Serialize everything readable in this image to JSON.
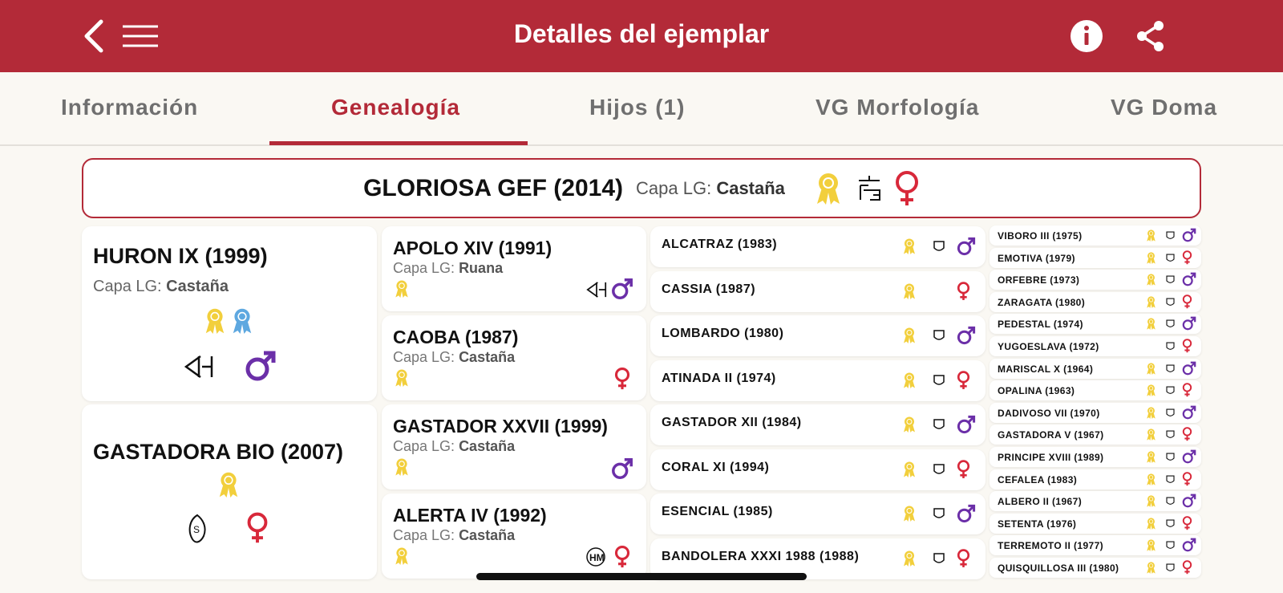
{
  "header": {
    "title": "Detalles del ejemplar",
    "icons": [
      "back-icon",
      "menu-icon",
      "info-icon",
      "share-icon"
    ]
  },
  "tabs": [
    {
      "label": "Información",
      "active": false
    },
    {
      "label": "Genealogía",
      "active": true
    },
    {
      "label": "Hijos (1)",
      "active": false
    },
    {
      "label": "VG Morfología",
      "active": false
    },
    {
      "label": "VG Doma",
      "active": false
    }
  ],
  "subject": {
    "name": "GLORIOSA GEF (2014)",
    "capa_label": "Capa LG:",
    "capa_value": "Castaña",
    "sex": "female",
    "icons": [
      "yellow-rosette-icon",
      "brand-mark-icon",
      "female-icon"
    ]
  },
  "parents": [
    {
      "name": "HURON IX (1999)",
      "capa_label": "Capa LG:",
      "capa_value": "Castaña",
      "sex": "male",
      "icons": [
        "yellow-rosette-icon",
        "blue-rosette-icon",
        "brand-mark-icon",
        "male-icon"
      ]
    },
    {
      "name": "GASTADORA BIO (2007)",
      "sex": "female",
      "icons": [
        "yellow-rosette-icon",
        "brand-mark-icon",
        "female-icon"
      ]
    }
  ],
  "grandparents": [
    {
      "name": "APOLO XIV (1991)",
      "capa_label": "Capa LG:",
      "capa_value": "Ruana",
      "sex": "male"
    },
    {
      "name": "CAOBA (1987)",
      "capa_label": "Capa LG:",
      "capa_value": "Castaña",
      "sex": "female"
    },
    {
      "name": "GASTADOR XXVII (1999)",
      "capa_label": "Capa LG:",
      "capa_value": "Castaña",
      "sex": "male"
    },
    {
      "name": "ALERTA IV (1992)",
      "capa_label": "Capa LG:",
      "capa_value": "Castaña",
      "sex": "female"
    }
  ],
  "great_grandparents": [
    {
      "name": "ALCATRAZ (1983)",
      "sex": "male"
    },
    {
      "name": "CASSIA (1987)",
      "sex": "female"
    },
    {
      "name": "LOMBARDO (1980)",
      "sex": "male"
    },
    {
      "name": "ATINADA II (1974)",
      "sex": "female"
    },
    {
      "name": "GASTADOR XII (1984)",
      "sex": "male"
    },
    {
      "name": "CORAL XI (1994)",
      "sex": "female"
    },
    {
      "name": "ESENCIAL (1985)",
      "sex": "male"
    },
    {
      "name": "BANDOLERA XXXI 1988 (1988)",
      "sex": "female"
    }
  ],
  "great_great_grandparents": [
    {
      "name": "VIBORO III (1975)",
      "sex": "male"
    },
    {
      "name": "EMOTIVA (1979)",
      "sex": "female"
    },
    {
      "name": "ORFEBRE (1973)",
      "sex": "male"
    },
    {
      "name": "ZARAGATA (1980)",
      "sex": "female"
    },
    {
      "name": "PEDESTAL (1974)",
      "sex": "male"
    },
    {
      "name": "YUGOESLAVA (1972)",
      "sex": "female"
    },
    {
      "name": "MARISCAL X (1964)",
      "sex": "male"
    },
    {
      "name": "OPALINA (1963)",
      "sex": "female"
    },
    {
      "name": "DADIVOSO VII (1970)",
      "sex": "male"
    },
    {
      "name": "GASTADORA V (1967)",
      "sex": "female"
    },
    {
      "name": "PRINCIPE XVIII (1989)",
      "sex": "male"
    },
    {
      "name": "CEFALEA (1983)",
      "sex": "female"
    },
    {
      "name": "ALBERO II (1967)",
      "sex": "male"
    },
    {
      "name": "SETENTA (1976)",
      "sex": "female"
    },
    {
      "name": "TERREMOTO II (1977)",
      "sex": "male"
    },
    {
      "name": "QUISQUILLOSA III (1980)",
      "sex": "female"
    }
  ],
  "colors": {
    "brand_red": "#b32a38",
    "male": "#6b2fa8",
    "female": "#d8283a",
    "rosette_yellow": "#f2cf3c",
    "rosette_blue": "#5ea8e0"
  }
}
